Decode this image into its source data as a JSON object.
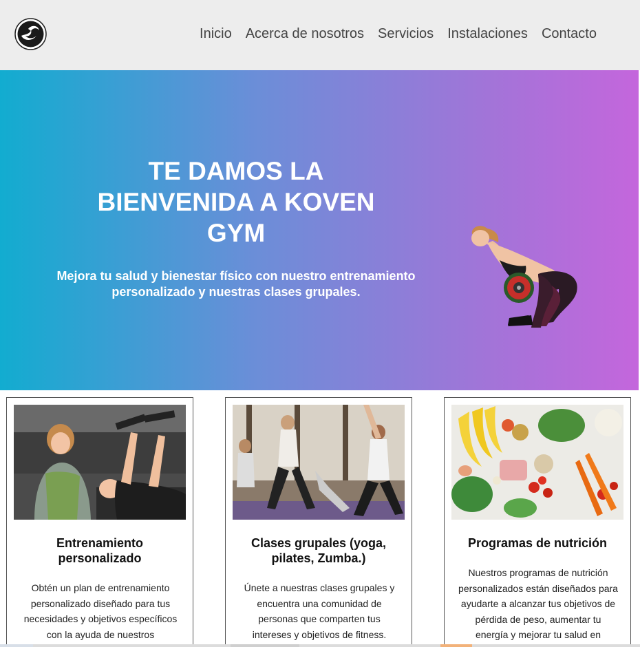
{
  "header": {
    "logo_icon": "swirl-logo-icon",
    "nav": [
      {
        "label": "Inicio"
      },
      {
        "label": "Acerca de nosotros"
      },
      {
        "label": "Servicios"
      },
      {
        "label": "Instalaciones"
      },
      {
        "label": "Contacto"
      }
    ]
  },
  "hero": {
    "title_line1": "TE DAMOS LA",
    "title_line2": "BIENVENIDA A KOVEN",
    "title_line3": "GYM",
    "subtitle_line1": "Mejora tu salud y bienestar físico con nuestro entrenamiento",
    "subtitle_line2": "personalizado y nuestras clases grupales.",
    "gradient": [
      "#12acd0",
      "#c466dc"
    ]
  },
  "cards": [
    {
      "title_line1": "Entrenamiento",
      "title_line2": "personalizado",
      "text": [
        "Obtén un plan de entrenamiento",
        "personalizado diseñado para tus",
        "necesidades y objetivos específicos",
        "con la ayuda de nuestros"
      ]
    },
    {
      "title_line1": "Clases grupales (yoga,",
      "title_line2": "pilates, Zumba.)",
      "text": [
        "Únete a nuestras clases grupales y",
        "encuentra una comunidad de",
        "personas que comparten tus",
        "intereses y objetivos de fitness."
      ]
    },
    {
      "title_line1": "Programas de nutrición",
      "text": [
        "Nuestros programas de nutrición",
        "personalizados están diseñados para",
        "ayudarte a alcanzar tus objetivos de",
        "pérdida de peso, aumentar tu",
        "energía y mejorar tu salud en"
      ]
    }
  ]
}
